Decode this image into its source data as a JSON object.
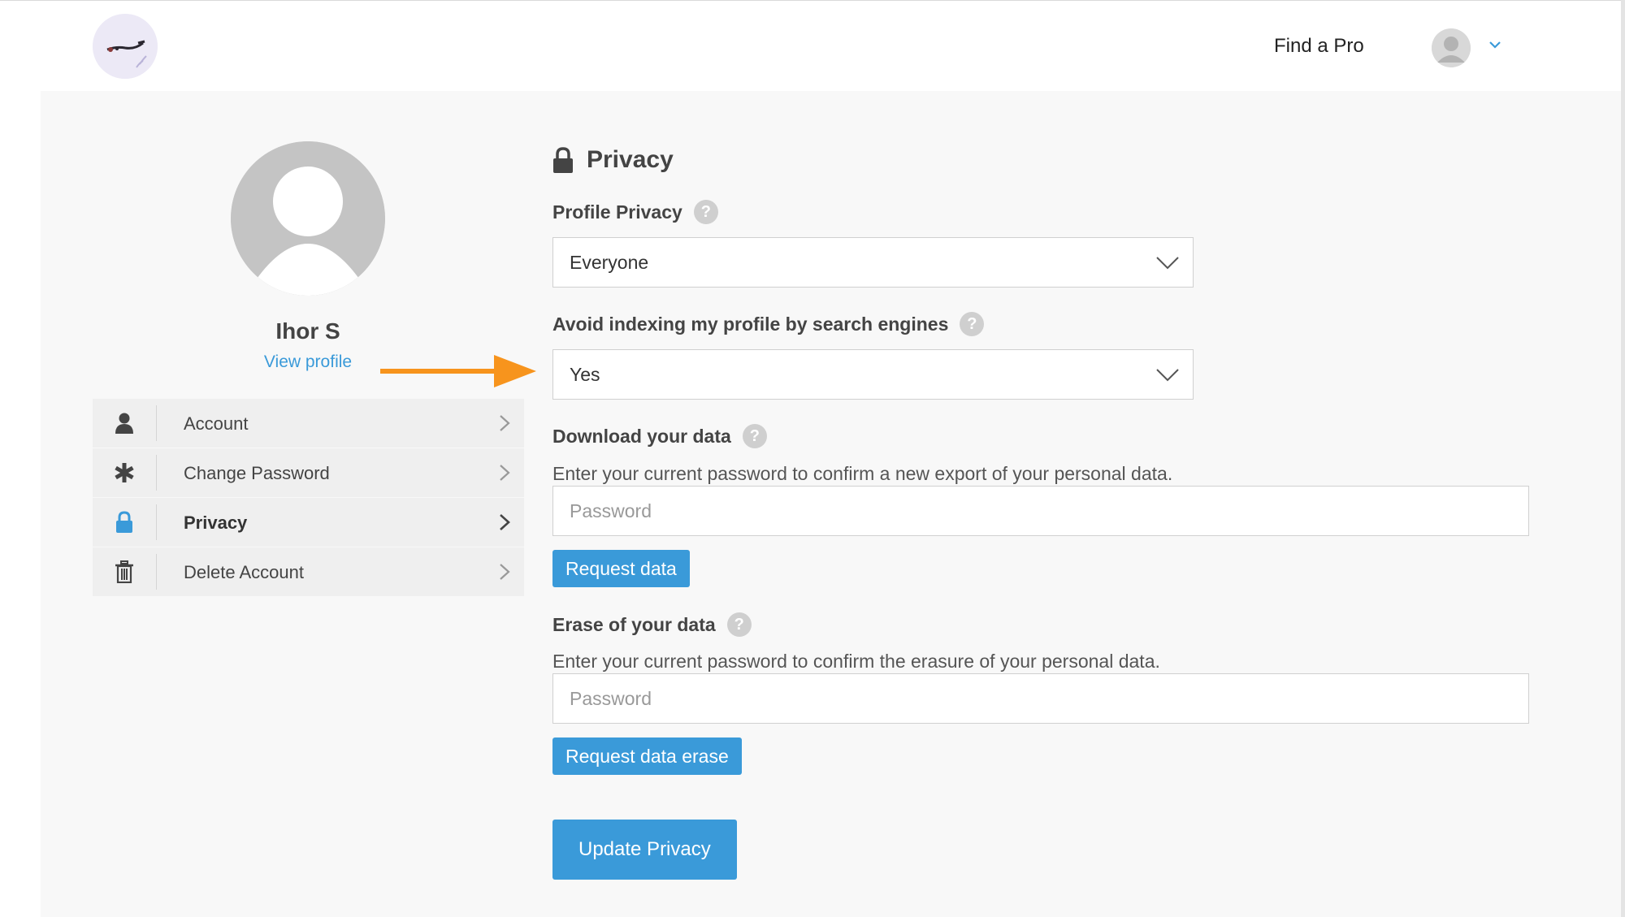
{
  "header": {
    "find_a_pro": "Find a Pro"
  },
  "profile": {
    "name": "Ihor S",
    "view_profile": "View profile"
  },
  "sidebar": {
    "items": [
      {
        "label": "Account",
        "icon": "user-icon",
        "active": false
      },
      {
        "label": "Change Password",
        "icon": "asterisk-icon",
        "active": false
      },
      {
        "label": "Privacy",
        "icon": "lock-icon",
        "active": true
      },
      {
        "label": "Delete Account",
        "icon": "trash-icon",
        "active": false
      }
    ]
  },
  "privacy": {
    "title": "Privacy",
    "profile_privacy": {
      "label": "Profile Privacy",
      "value": "Everyone"
    },
    "avoid_indexing": {
      "label": "Avoid indexing my profile by search engines",
      "value": "Yes"
    },
    "download": {
      "label": "Download your data",
      "description": "Enter your current password to confirm a new export of your personal data.",
      "placeholder": "Password",
      "button": "Request data"
    },
    "erase": {
      "label": "Erase of your data",
      "description": "Enter your current password to confirm the erasure of your personal data.",
      "placeholder": "Password",
      "button": "Request data erase"
    },
    "update_button": "Update Privacy",
    "help_glyph": "?"
  },
  "colors": {
    "accent": "#3a9ad9",
    "annotation_arrow": "#f7941d",
    "content_bg": "#f8f8f8",
    "sidebar_bg": "#efefef"
  }
}
